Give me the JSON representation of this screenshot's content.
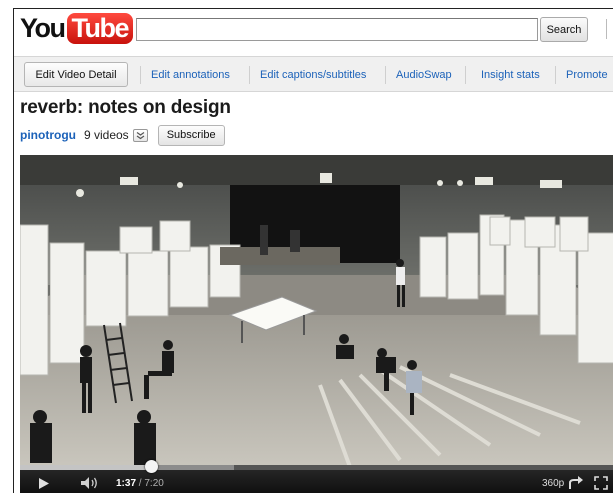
{
  "masthead": {
    "logo_you": "You",
    "logo_tube": "Tube",
    "search_value": "",
    "search_button": "Search"
  },
  "toolbar": {
    "edit_video_detail": "Edit Video Detail",
    "links": [
      "Edit annotations",
      "Edit captions/subtitles",
      "AudioSwap",
      "Insight stats",
      "Promote"
    ]
  },
  "video": {
    "title": "reverb: notes on design",
    "channel": "pinotrogu",
    "video_count": "9 videos",
    "subscribe": "Subscribe"
  },
  "player": {
    "current_time": "1:37",
    "duration": "/ 7:20",
    "quality": "360p",
    "progress_fraction": 0.22,
    "buffered_fraction": 0.36,
    "icons": [
      "play-icon",
      "volume-icon",
      "share-icon",
      "fullscreen-icon"
    ]
  },
  "colors": {
    "link": "#1c62b9",
    "logo_red": "#e62117"
  }
}
